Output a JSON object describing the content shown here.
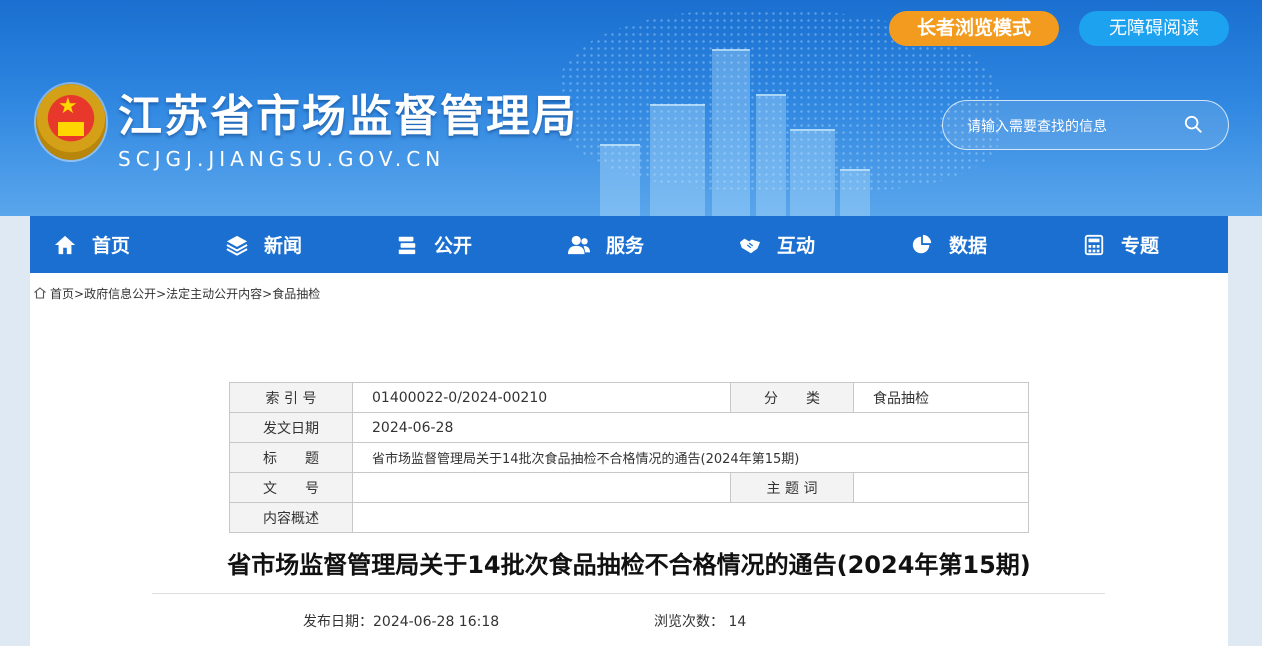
{
  "header": {
    "site_title": "江苏省市场监督管理局",
    "site_url": "SCJGJ.JIANGSU.GOV.CN",
    "elder_mode_label": "长者浏览模式",
    "accessibility_label": "无障碍阅读",
    "search_placeholder": "请输入需要查找的信息"
  },
  "nav": {
    "items": [
      {
        "label": "首页",
        "icon": "home-icon"
      },
      {
        "label": "新闻",
        "icon": "layers-icon"
      },
      {
        "label": "公开",
        "icon": "stack-icon"
      },
      {
        "label": "服务",
        "icon": "users-icon"
      },
      {
        "label": "互动",
        "icon": "handshake-icon"
      },
      {
        "label": "数据",
        "icon": "pie-chart-icon"
      },
      {
        "label": "专题",
        "icon": "calculator-icon"
      }
    ]
  },
  "breadcrumb": [
    "首页",
    "政府信息公开",
    "法定主动公开内容",
    "食品抽检"
  ],
  "meta_table": {
    "index_label": "索 引 号",
    "index_value": "01400022-0/2024-00210",
    "category_label": "分　　类",
    "category_value": "食品抽检",
    "date_label": "发文日期",
    "date_value": "2024-06-28",
    "title_label": "标　　题",
    "title_value": "省市场监督管理局关于14批次食品抽检不合格情况的通告(2024年第15期)",
    "doc_no_label": "文　　号",
    "doc_no_value": "",
    "keywords_label": "主 题 词",
    "keywords_value": "",
    "summary_label": "内容概述",
    "summary_value": ""
  },
  "article": {
    "title": "省市场监督管理局关于14批次食品抽检不合格情况的通告(2024年第15期)",
    "publish_date_label": "发布日期：",
    "publish_date": "2024-06-28 16:18",
    "views_label": "浏览次数：",
    "views": "14"
  },
  "colors": {
    "header_blue": "#1a6fd0",
    "nav_blue": "#1a6fd0",
    "elder_orange": "#f39b1e",
    "access_blue": "#1da2f0"
  }
}
